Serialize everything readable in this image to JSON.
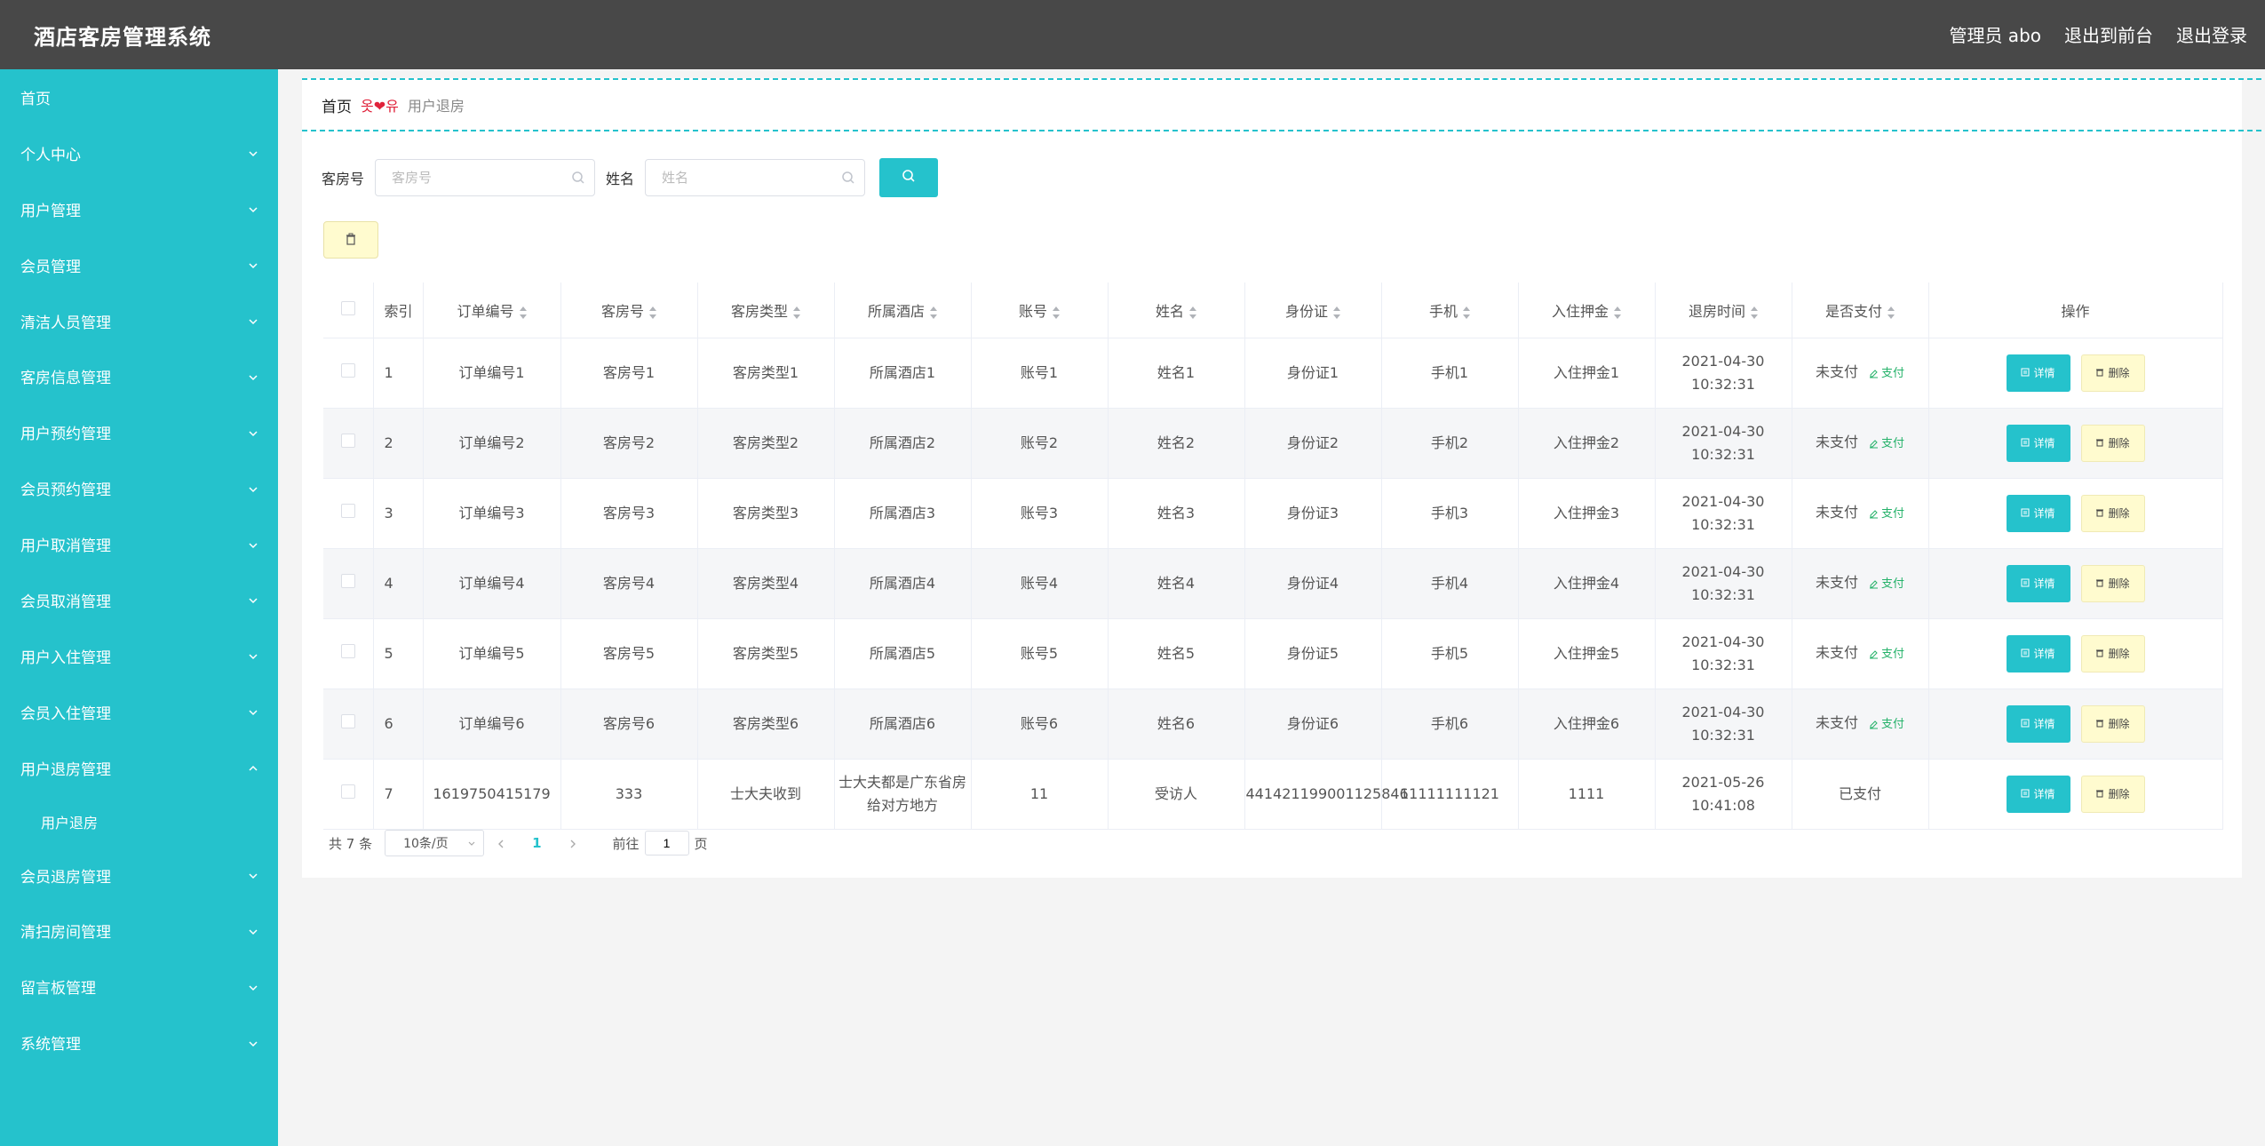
{
  "header": {
    "title": "酒店客房管理系统",
    "admin_label": "管理员 abo",
    "to_front": "退出到前台",
    "logout": "退出登录"
  },
  "sidebar": {
    "home": "首页",
    "items": [
      "个人中心",
      "用户管理",
      "会员管理",
      "清洁人员管理",
      "客房信息管理",
      "用户预约管理",
      "会员预约管理",
      "用户取消管理",
      "会员取消管理",
      "用户入住管理",
      "会员入住管理",
      "用户退房管理"
    ],
    "expanded_sub": "用户退房",
    "items_after": [
      "会员退房管理",
      "清扫房间管理",
      "留言板管理",
      "系统管理"
    ]
  },
  "breadcrumb": {
    "home": "首页",
    "sep": "옷❤유",
    "current": "用户退房"
  },
  "search": {
    "room_label": "客房号",
    "room_placeholder": "客房号",
    "name_label": "姓名",
    "name_placeholder": "姓名"
  },
  "table": {
    "columns": [
      "索引",
      "订单编号",
      "客房号",
      "客房类型",
      "所属酒店",
      "账号",
      "姓名",
      "身份证",
      "手机",
      "入住押金",
      "退房时间",
      "是否支付",
      "操作"
    ],
    "pay_link": "支付",
    "detail_btn": "详情",
    "delete_btn": "删除",
    "rows": [
      {
        "idx": "1",
        "order": "订单编号1",
        "room": "客房号1",
        "type": "客房类型1",
        "hotel": "所属酒店1",
        "account": "账号1",
        "name": "姓名1",
        "idcard": "身份证1",
        "phone": "手机1",
        "deposit": "入住押金1",
        "time": "2021-04-30 10:32:31",
        "paid": "未支付",
        "unpaid": true
      },
      {
        "idx": "2",
        "order": "订单编号2",
        "room": "客房号2",
        "type": "客房类型2",
        "hotel": "所属酒店2",
        "account": "账号2",
        "name": "姓名2",
        "idcard": "身份证2",
        "phone": "手机2",
        "deposit": "入住押金2",
        "time": "2021-04-30 10:32:31",
        "paid": "未支付",
        "unpaid": true
      },
      {
        "idx": "3",
        "order": "订单编号3",
        "room": "客房号3",
        "type": "客房类型3",
        "hotel": "所属酒店3",
        "account": "账号3",
        "name": "姓名3",
        "idcard": "身份证3",
        "phone": "手机3",
        "deposit": "入住押金3",
        "time": "2021-04-30 10:32:31",
        "paid": "未支付",
        "unpaid": true
      },
      {
        "idx": "4",
        "order": "订单编号4",
        "room": "客房号4",
        "type": "客房类型4",
        "hotel": "所属酒店4",
        "account": "账号4",
        "name": "姓名4",
        "idcard": "身份证4",
        "phone": "手机4",
        "deposit": "入住押金4",
        "time": "2021-04-30 10:32:31",
        "paid": "未支付",
        "unpaid": true
      },
      {
        "idx": "5",
        "order": "订单编号5",
        "room": "客房号5",
        "type": "客房类型5",
        "hotel": "所属酒店5",
        "account": "账号5",
        "name": "姓名5",
        "idcard": "身份证5",
        "phone": "手机5",
        "deposit": "入住押金5",
        "time": "2021-04-30 10:32:31",
        "paid": "未支付",
        "unpaid": true
      },
      {
        "idx": "6",
        "order": "订单编号6",
        "room": "客房号6",
        "type": "客房类型6",
        "hotel": "所属酒店6",
        "account": "账号6",
        "name": "姓名6",
        "idcard": "身份证6",
        "phone": "手机6",
        "deposit": "入住押金6",
        "time": "2021-04-30 10:32:31",
        "paid": "未支付",
        "unpaid": true
      },
      {
        "idx": "7",
        "order": "1619750415179",
        "room": "333",
        "type": "士大夫收到",
        "hotel": "士大夫都是广东省房给对方地方",
        "account": "11",
        "name": "受访人",
        "idcard": "441421199001125846",
        "phone": "11111111121",
        "deposit": "1111",
        "time": "2021-05-26 10:41:08",
        "paid": "已支付",
        "unpaid": false
      }
    ]
  },
  "pagination": {
    "total": "共 7 条",
    "page_size": "10条/页",
    "current": "1",
    "goto_prefix": "前往",
    "goto_value": "1",
    "goto_suffix": "页"
  }
}
